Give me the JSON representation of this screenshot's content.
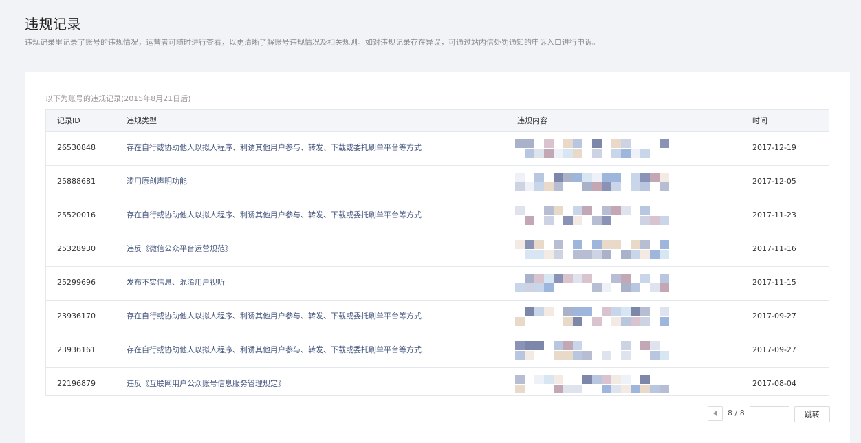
{
  "page": {
    "title": "违规记录",
    "description": "违规记录里记录了账号的违规情况，运营者可随时进行查看，以更清晰了解账号违规情况及相关规则。如对违规记录存在异议，可通过站内信处罚通知的申诉入口进行申诉。"
  },
  "records": {
    "caption": "以下为账号的违规记录(2015年8月21日后)",
    "columns": {
      "id": "记录ID",
      "type": "违规类型",
      "content": "违规内容",
      "time": "时间"
    },
    "rows": [
      {
        "id": "26530848",
        "type": "存在自行或协助他人以拟人程序、利诱其他用户参与、转发、下载或委托刷单平台等方式",
        "content": "[redacted]",
        "time": "2017-12-19"
      },
      {
        "id": "25888681",
        "type": "滥用原创声明功能",
        "content": "[redacted]",
        "time": "2017-12-05"
      },
      {
        "id": "25520016",
        "type": "存在自行或协助他人以拟人程序、利诱其他用户参与、转发、下载或委托刷单平台等方式",
        "content": "[redacted]",
        "time": "2017-11-23"
      },
      {
        "id": "25328930",
        "type": "违反《微信公众平台运营规范》",
        "content": "[redacted]",
        "time": "2017-11-16"
      },
      {
        "id": "25299696",
        "type": "发布不实信息、混淆用户视听",
        "content": "[redacted]",
        "time": "2017-11-15"
      },
      {
        "id": "23936170",
        "type": "存在自行或协助他人以拟人程序、利诱其他用户参与、转发、下载或委托刷单平台等方式",
        "content": "[redacted]",
        "time": "2017-09-27"
      },
      {
        "id": "23936161",
        "type": "存在自行或协助他人以拟人程序、利诱其他用户参与、转发、下载或委托刷单平台等方式",
        "content": "[redacted]",
        "time": "2017-09-27"
      },
      {
        "id": "22196879",
        "type": "违反《互联网用户公众账号信息服务管理规定》",
        "content": "[redacted]",
        "time": "2017-08-04"
      }
    ]
  },
  "pagination": {
    "info": "8 / 8",
    "jump_input_value": "",
    "jump_label": "跳转"
  },
  "colors": {
    "background": "#f2f3f7",
    "panel": "#ffffff",
    "header_bg": "#f4f5f9",
    "type_link": "#47587f",
    "border": "#e4e8eb"
  }
}
